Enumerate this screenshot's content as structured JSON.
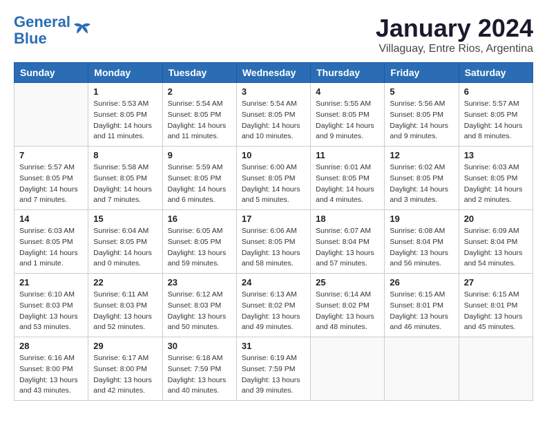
{
  "logo": {
    "line1": "General",
    "line2": "Blue"
  },
  "title": "January 2024",
  "subtitle": "Villaguay, Entre Rios, Argentina",
  "days_of_week": [
    "Sunday",
    "Monday",
    "Tuesday",
    "Wednesday",
    "Thursday",
    "Friday",
    "Saturday"
  ],
  "weeks": [
    [
      {
        "day": "",
        "info": ""
      },
      {
        "day": "1",
        "info": "Sunrise: 5:53 AM\nSunset: 8:05 PM\nDaylight: 14 hours\nand 11 minutes."
      },
      {
        "day": "2",
        "info": "Sunrise: 5:54 AM\nSunset: 8:05 PM\nDaylight: 14 hours\nand 11 minutes."
      },
      {
        "day": "3",
        "info": "Sunrise: 5:54 AM\nSunset: 8:05 PM\nDaylight: 14 hours\nand 10 minutes."
      },
      {
        "day": "4",
        "info": "Sunrise: 5:55 AM\nSunset: 8:05 PM\nDaylight: 14 hours\nand 9 minutes."
      },
      {
        "day": "5",
        "info": "Sunrise: 5:56 AM\nSunset: 8:05 PM\nDaylight: 14 hours\nand 9 minutes."
      },
      {
        "day": "6",
        "info": "Sunrise: 5:57 AM\nSunset: 8:05 PM\nDaylight: 14 hours\nand 8 minutes."
      }
    ],
    [
      {
        "day": "7",
        "info": "Sunrise: 5:57 AM\nSunset: 8:05 PM\nDaylight: 14 hours\nand 7 minutes."
      },
      {
        "day": "8",
        "info": "Sunrise: 5:58 AM\nSunset: 8:05 PM\nDaylight: 14 hours\nand 7 minutes."
      },
      {
        "day": "9",
        "info": "Sunrise: 5:59 AM\nSunset: 8:05 PM\nDaylight: 14 hours\nand 6 minutes."
      },
      {
        "day": "10",
        "info": "Sunrise: 6:00 AM\nSunset: 8:05 PM\nDaylight: 14 hours\nand 5 minutes."
      },
      {
        "day": "11",
        "info": "Sunrise: 6:01 AM\nSunset: 8:05 PM\nDaylight: 14 hours\nand 4 minutes."
      },
      {
        "day": "12",
        "info": "Sunrise: 6:02 AM\nSunset: 8:05 PM\nDaylight: 14 hours\nand 3 minutes."
      },
      {
        "day": "13",
        "info": "Sunrise: 6:03 AM\nSunset: 8:05 PM\nDaylight: 14 hours\nand 2 minutes."
      }
    ],
    [
      {
        "day": "14",
        "info": "Sunrise: 6:03 AM\nSunset: 8:05 PM\nDaylight: 14 hours\nand 1 minute."
      },
      {
        "day": "15",
        "info": "Sunrise: 6:04 AM\nSunset: 8:05 PM\nDaylight: 14 hours\nand 0 minutes."
      },
      {
        "day": "16",
        "info": "Sunrise: 6:05 AM\nSunset: 8:05 PM\nDaylight: 13 hours\nand 59 minutes."
      },
      {
        "day": "17",
        "info": "Sunrise: 6:06 AM\nSunset: 8:05 PM\nDaylight: 13 hours\nand 58 minutes."
      },
      {
        "day": "18",
        "info": "Sunrise: 6:07 AM\nSunset: 8:04 PM\nDaylight: 13 hours\nand 57 minutes."
      },
      {
        "day": "19",
        "info": "Sunrise: 6:08 AM\nSunset: 8:04 PM\nDaylight: 13 hours\nand 56 minutes."
      },
      {
        "day": "20",
        "info": "Sunrise: 6:09 AM\nSunset: 8:04 PM\nDaylight: 13 hours\nand 54 minutes."
      }
    ],
    [
      {
        "day": "21",
        "info": "Sunrise: 6:10 AM\nSunset: 8:03 PM\nDaylight: 13 hours\nand 53 minutes."
      },
      {
        "day": "22",
        "info": "Sunrise: 6:11 AM\nSunset: 8:03 PM\nDaylight: 13 hours\nand 52 minutes."
      },
      {
        "day": "23",
        "info": "Sunrise: 6:12 AM\nSunset: 8:03 PM\nDaylight: 13 hours\nand 50 minutes."
      },
      {
        "day": "24",
        "info": "Sunrise: 6:13 AM\nSunset: 8:02 PM\nDaylight: 13 hours\nand 49 minutes."
      },
      {
        "day": "25",
        "info": "Sunrise: 6:14 AM\nSunset: 8:02 PM\nDaylight: 13 hours\nand 48 minutes."
      },
      {
        "day": "26",
        "info": "Sunrise: 6:15 AM\nSunset: 8:01 PM\nDaylight: 13 hours\nand 46 minutes."
      },
      {
        "day": "27",
        "info": "Sunrise: 6:15 AM\nSunset: 8:01 PM\nDaylight: 13 hours\nand 45 minutes."
      }
    ],
    [
      {
        "day": "28",
        "info": "Sunrise: 6:16 AM\nSunset: 8:00 PM\nDaylight: 13 hours\nand 43 minutes."
      },
      {
        "day": "29",
        "info": "Sunrise: 6:17 AM\nSunset: 8:00 PM\nDaylight: 13 hours\nand 42 minutes."
      },
      {
        "day": "30",
        "info": "Sunrise: 6:18 AM\nSunset: 7:59 PM\nDaylight: 13 hours\nand 40 minutes."
      },
      {
        "day": "31",
        "info": "Sunrise: 6:19 AM\nSunset: 7:59 PM\nDaylight: 13 hours\nand 39 minutes."
      },
      {
        "day": "",
        "info": ""
      },
      {
        "day": "",
        "info": ""
      },
      {
        "day": "",
        "info": ""
      }
    ]
  ]
}
